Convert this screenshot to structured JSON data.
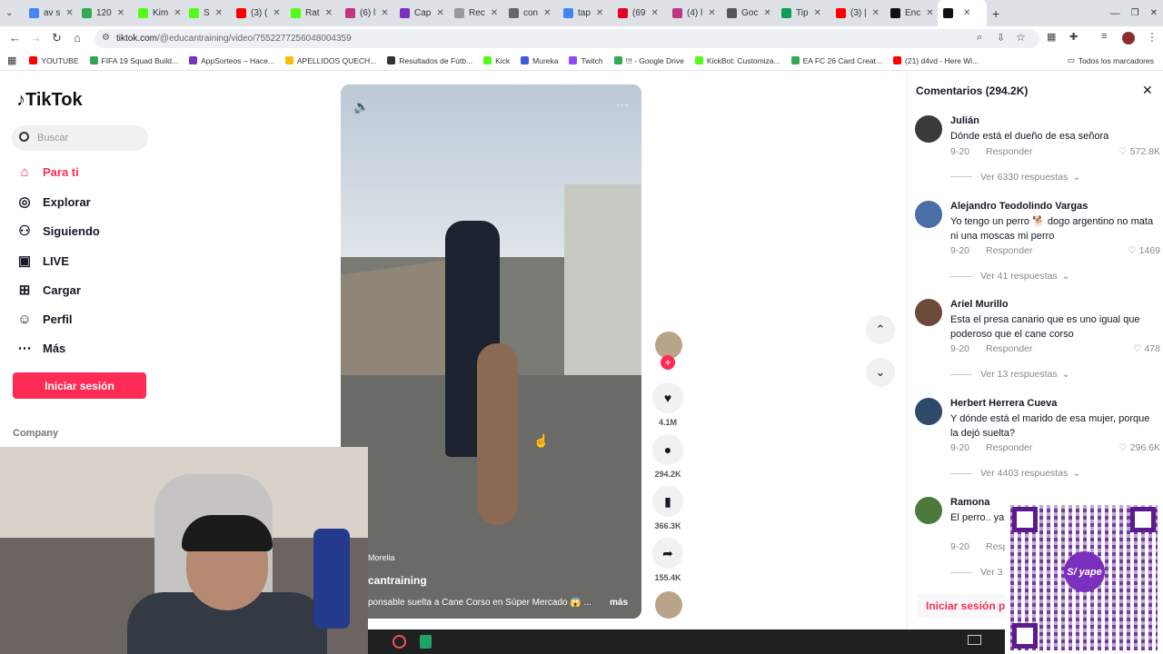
{
  "browser": {
    "tabs": [
      {
        "label": "av s",
        "color": "#4285f4"
      },
      {
        "label": "120",
        "color": "#34a853"
      },
      {
        "label": "Kim",
        "color": "#53fc18"
      },
      {
        "label": "S",
        "color": "#53fc18"
      },
      {
        "label": "(3) (",
        "color": "#ff0000"
      },
      {
        "label": "Rat",
        "color": "#53fc18"
      },
      {
        "label": "(6) l",
        "color": "#c13584"
      },
      {
        "label": "Cap",
        "color": "#7b2fbf"
      },
      {
        "label": "Rec",
        "color": "#999999"
      },
      {
        "label": "con",
        "color": "#666666"
      },
      {
        "label": "tap",
        "color": "#4285f4"
      },
      {
        "label": "(69",
        "color": "#e60023"
      },
      {
        "label": "(4) l",
        "color": "#c13584"
      },
      {
        "label": "Goc",
        "color": "#555555"
      },
      {
        "label": "Tip",
        "color": "#0f9d58"
      },
      {
        "label": "(3) |",
        "color": "#ff0000"
      },
      {
        "label": "Enc",
        "color": "#111111"
      },
      {
        "label": "",
        "color": "#111111",
        "active": true
      }
    ],
    "url_host": "tiktok.com",
    "url_path": "/@educantraining/video/7552277256048004359",
    "bookmarks": [
      {
        "label": "YOUTUBE",
        "color": "#ff0000"
      },
      {
        "label": "FIFA 19 Squad Build...",
        "color": "#2fa84f"
      },
      {
        "label": "AppSorteos – Hace...",
        "color": "#7b2fbf"
      },
      {
        "label": "APELLIDOS QUECH...",
        "color": "#fbbc05"
      },
      {
        "label": "Resultados de Fútb...",
        "color": "#333333"
      },
      {
        "label": "Kick",
        "color": "#53fc18"
      },
      {
        "label": "Mureka",
        "color": "#3b5bdb"
      },
      {
        "label": "Twitch",
        "color": "#9146ff"
      },
      {
        "label": "!!! - Google Drive",
        "color": "#34a853"
      },
      {
        "label": "KickBot: Customiza...",
        "color": "#53fc18"
      },
      {
        "label": "EA FC 26 Card Creat...",
        "color": "#2fa84f"
      },
      {
        "label": "(21) d4vd - Here Wi...",
        "color": "#ff0000"
      }
    ],
    "all_bookmarks": "Todos los marcadores"
  },
  "sidebar": {
    "logo": "TikTok",
    "search_placeholder": "Buscar",
    "items": [
      {
        "label": "Para ti",
        "icon": "home-icon",
        "glyph": "⌂"
      },
      {
        "label": "Explorar",
        "icon": "compass-icon",
        "glyph": "◎"
      },
      {
        "label": "Siguiendo",
        "icon": "following-icon",
        "glyph": "⚇"
      },
      {
        "label": "LIVE",
        "icon": "live-icon",
        "glyph": "▣"
      },
      {
        "label": "Cargar",
        "icon": "upload-icon",
        "glyph": "⊞"
      },
      {
        "label": "Perfil",
        "icon": "profile-icon",
        "glyph": "☺"
      },
      {
        "label": "Más",
        "icon": "more-icon",
        "glyph": "⋯"
      }
    ],
    "login": "Iniciar sesión",
    "company": "Company"
  },
  "video": {
    "location": "Morelia",
    "author": "cantraining",
    "caption": "ponsable suelta a Cane Corso en Súper Mercado 😱 ...",
    "more": "más"
  },
  "actions": {
    "likes": "4.1M",
    "comments": "294.2K",
    "saves": "366.3K",
    "shares": "155.4K"
  },
  "comments_panel": {
    "title": "Comentarios (294.2K)",
    "reply_label": "Responder",
    "items": [
      {
        "name": "Julián",
        "text": "Dónde está el dueño de esa señora",
        "date": "9-20",
        "likes": "572.8K",
        "more": "Ver 6330 respuestas",
        "avatar": "#3a3a3a"
      },
      {
        "name": "Alejandro Teodolindo Vargas",
        "text": "Yo tengo un perro 🐕 dogo argentino no mata ni una moscas mi perro",
        "date": "9-20",
        "likes": "1469",
        "more": "Ver 41 respuestas",
        "avatar": "#4a6fa5"
      },
      {
        "name": "Ariel Murillo",
        "text": "Esta el presa canario que es uno igual que poderoso que el cane corso",
        "date": "9-20",
        "likes": "478",
        "more": "Ver 13 respuestas",
        "avatar": "#6b4a3a"
      },
      {
        "name": "Herbert Herrera Cueva",
        "text": "Y dónde está el marido de esa mujer, porque la dejó suelta?",
        "date": "9-20",
        "likes": "296.6K",
        "more": "Ver 4403 respuestas",
        "avatar": "#2d4a6b"
      },
      {
        "name": "Ramona",
        "text": "El perro.. ya vaya a mord",
        "date": "9-20",
        "likes": "",
        "more": "Ver 3",
        "avatar": "#4c7a3a"
      }
    ],
    "login": "Iniciar sesión pa"
  },
  "overlay": {
    "qr_label": "S/ yape"
  }
}
